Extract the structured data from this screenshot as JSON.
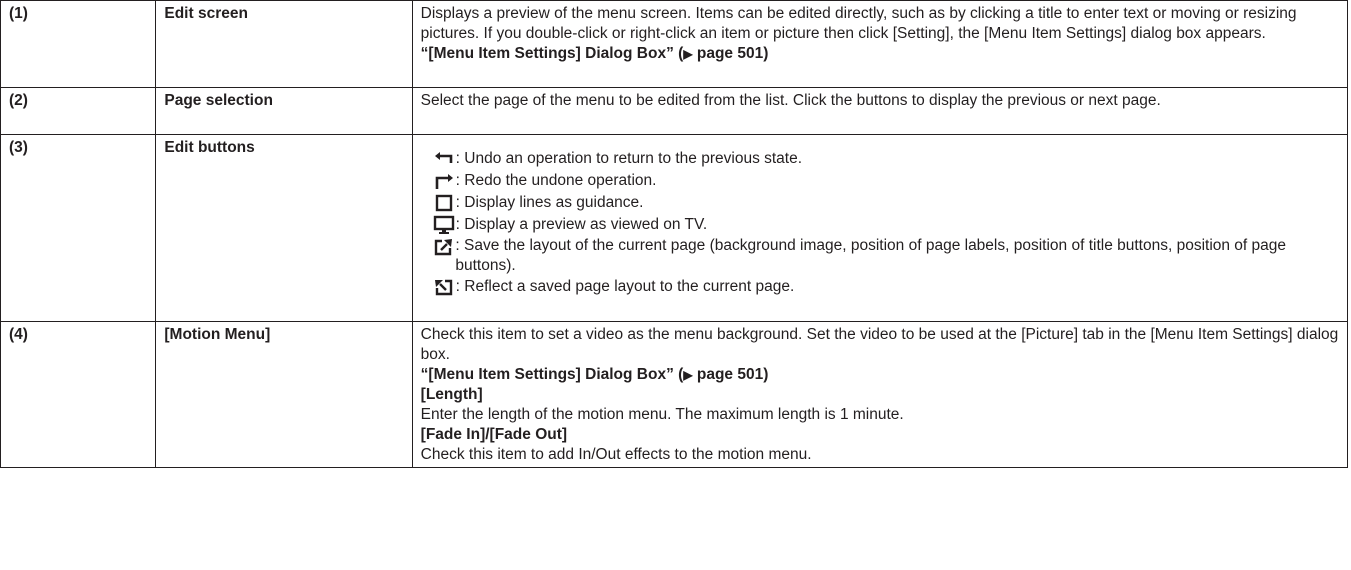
{
  "rows": [
    {
      "num": "(1)",
      "name": "Edit screen",
      "desc": "Displays a preview of the menu screen. Items can be edited directly, such as by clicking a title to enter text or moving or resizing pictures. If you double-click or right-click an item or picture then click [Setting], the [Menu Item Settings] dialog box appears.",
      "ref": "“[Menu Item Settings] Dialog Box” (",
      "ref_tail": " page 501)"
    },
    {
      "num": "(2)",
      "name": "Page selection",
      "desc": "Select the page of the menu to be edited from the list. Click the buttons to display the previous or next page."
    },
    {
      "num": "(3)",
      "name": "Edit buttons",
      "buttons": [
        {
          "icon": "undo-icon",
          "text": ": Undo an operation to return to the previous state."
        },
        {
          "icon": "redo-icon",
          "text": ": Redo the undone operation."
        },
        {
          "icon": "guide-icon",
          "text": ": Display lines as guidance."
        },
        {
          "icon": "tv-preview-icon",
          "text": ": Display a preview as viewed on TV."
        },
        {
          "icon": "save-layout-icon",
          "text": ": Save the layout of the current page (background image, position of page labels, position of title buttons, position of page buttons)."
        },
        {
          "icon": "apply-layout-icon",
          "text": ": Reflect a saved page layout to the current page."
        }
      ]
    },
    {
      "num": "(4)",
      "name": "[Motion Menu]",
      "desc": "Check this item to set a video as the menu background. Set the video to be used at the [Picture] tab in the [Menu Item Settings] dialog box.",
      "ref": "“[Menu Item Settings] Dialog Box” (",
      "ref_tail": " page 501)",
      "sub1_title": "[Length]",
      "sub1_text": "Enter the length of the motion menu. The maximum length is 1 minute.",
      "sub2_title": "[Fade In]/[Fade Out]",
      "sub2_text": "Check this item to add In/Out effects to the motion menu."
    }
  ]
}
